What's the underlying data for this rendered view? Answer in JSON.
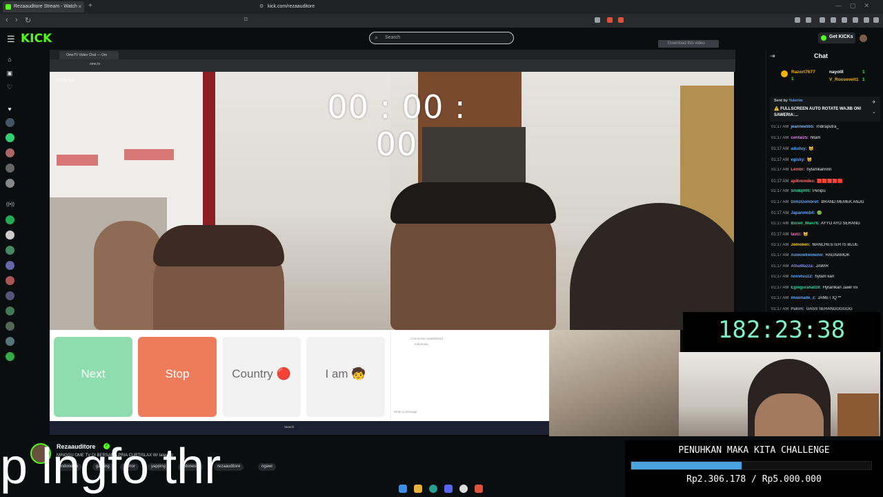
{
  "browser": {
    "tab_title": "Rezaauditore Stream - Watch",
    "url": "kick.com/rezaauditore",
    "new_tab": "+",
    "close_tab": "×"
  },
  "header": {
    "logo": "KICK",
    "search_placeholder": "Search",
    "get_kicks": "Get KICKs",
    "download_video": "Download this video"
  },
  "stream_video": {
    "inner_tab_title": "OmeTV Video Chat — Om",
    "inner_url": "ome.tv",
    "ometv_logo": "Ome.tv",
    "call_timer": "00 : 00 : 00",
    "buttons": {
      "next": "Next",
      "stop": "Stop",
      "country": "Country 🔴",
      "i_am": "I am 🧒"
    },
    "chat_status": "Connection established.",
    "chat_country": "Indonesia",
    "chat_input_placeholder": "Write a message",
    "inner_search": "Search"
  },
  "overlay": {
    "stream_timer": "182:23:38",
    "big_text": "p lngfo thr",
    "challenge_title": "PENUHKAN MAKA KITA CHALLENGE",
    "challenge_amount": "Rp2.306.178 / Rp5.000.000",
    "challenge_progress": 0.46
  },
  "chat": {
    "title": "Chat",
    "gifters": [
      {
        "name": "Razort7677",
        "count": "1"
      },
      {
        "name": "nayolll",
        "count": "1"
      },
      {
        "name": "V_Roosevelt1",
        "count": "1"
      }
    ],
    "pinned_sender": "Sent by",
    "pinned_by": "Yuterim",
    "pinned_line1": "⚠️ FULLSCREEN AUTO ROTATE WAJIB ON!",
    "pinned_line2": "SAWERIA:...",
    "messages": [
      {
        "time": "01:17 AM",
        "user": "jeannee555:",
        "text": "rndiraputra_",
        "color": "#7ab4ff"
      },
      {
        "time": "01:17 AM",
        "user": "centalz5:",
        "text": "hitam",
        "color": "#e879f9"
      },
      {
        "time": "01:17 AM",
        "user": "aduduy:",
        "text": "😺",
        "color": "#60a5fa"
      },
      {
        "time": "01:17 AM",
        "user": "egisky:",
        "text": "😺",
        "color": "#60a5fa"
      },
      {
        "time": "01:17 AM",
        "user": "Lembr:",
        "text": "hytamkannnn",
        "color": "#f87171"
      },
      {
        "time": "01:17 AM",
        "user": "apiknondes:",
        "text": "🟥🟥🟥🟥🟥",
        "color": "#f87171"
      },
      {
        "time": "01:17 AM",
        "user": "ShidqiRR:",
        "text": "Penipu",
        "color": "#34d399"
      },
      {
        "time": "01:17 AM",
        "user": "DimzGombret:",
        "text": "BRAND MEMEK ANJG",
        "color": "#60a5fa"
      },
      {
        "time": "01:17 AM",
        "user": "Japanmobil:",
        "text": "🟢",
        "color": "#60a5fa"
      },
      {
        "time": "01:17 AM",
        "user": "Bored_Man76:",
        "text": "AYYO AYO SERANG",
        "color": "#34d399"
      },
      {
        "time": "01:17 AM",
        "user": "lastz:",
        "text": "😺",
        "color": "#f472b6"
      },
      {
        "time": "01:17 AM",
        "user": "Jomoken:",
        "text": "MANCHESTER IS BLUE",
        "color": "#facc15"
      },
      {
        "time": "01:17 AM",
        "user": "Aowowkwowow:",
        "text": "RAGNAMOK",
        "color": "#60a5fa"
      },
      {
        "time": "01:17 AM",
        "user": "AthaWazza:",
        "text": "JAWIR",
        "color": "#818cf8"
      },
      {
        "time": "01:17 AM",
        "user": "noiretsu12:",
        "text": "hytam kan",
        "color": "#60a5fa"
      },
      {
        "time": "01:17 AM",
        "user": "Egingurahat19:",
        "text": "Hytamkan Jawir ini",
        "color": "#34d399"
      },
      {
        "time": "01:17 AM",
        "user": "imaonade_z:",
        "text": "JAMET IQ **",
        "color": "#60a5fa"
      },
      {
        "time": "01:17 AM",
        "user": "Pakim:",
        "text": "GASS SERANGGGGGG",
        "color": "#9ca3af"
      }
    ]
  },
  "streamer": {
    "name": "Rezaauditore",
    "title": "MINGGU OME TV DI BERSAMA PRIA CURTISLAX W/ lalay.co",
    "tags": [
      "Indonesia",
      "gaming",
      "Horror",
      "yapping",
      "Indonesia",
      "rezaauditore",
      "ngawi"
    ]
  },
  "colors": {
    "kick_green": "#53fc18",
    "next_button": "#8fdcb0",
    "stop_button": "#ef7b5d",
    "timer_color": "#7ef2c8",
    "progress_fill": "#4aa3df"
  }
}
